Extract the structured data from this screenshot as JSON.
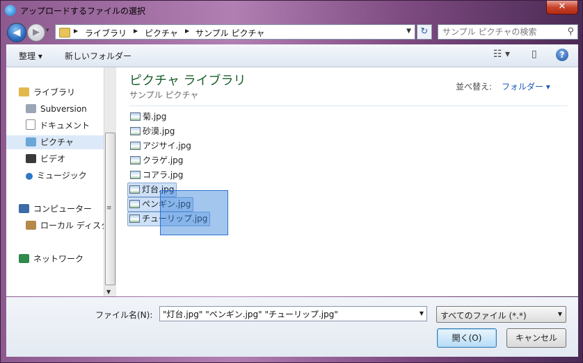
{
  "window": {
    "title": "アップロードするファイルの選択",
    "close_label": "✕"
  },
  "nav": {
    "back_label": "◀",
    "forward_label": "▶",
    "history_label": "▾",
    "breadcrumbs": [
      "ライブラリ",
      "ピクチャ",
      "サンプル ピクチャ"
    ],
    "search_placeholder": "サンプル ピクチャの検索",
    "refresh_label": "↻"
  },
  "toolbar": {
    "organize_label": "整理 ▾",
    "new_folder_label": "新しいフォルダー"
  },
  "sidebar": {
    "items": [
      {
        "label": "ライブラリ",
        "icon": "library-icon",
        "color": "#e2b84c"
      },
      {
        "label": "Subversion",
        "icon": "subversion-icon",
        "color": "#7a8aa0"
      },
      {
        "label": "ドキュメント",
        "icon": "document-icon",
        "color": "#ffffff"
      },
      {
        "label": "ピクチャ",
        "icon": "picture-icon",
        "color": "#6aa7d8"
      },
      {
        "label": "ビデオ",
        "icon": "video-icon",
        "color": "#3a3a3a"
      },
      {
        "label": "ミュージック",
        "icon": "music-icon",
        "color": "#2d78c8"
      },
      {
        "label": "コンピューター",
        "icon": "computer-icon",
        "color": "#3d6aa8"
      },
      {
        "label": "ローカル ディスク",
        "icon": "disk-icon",
        "color": "#b4894a"
      },
      {
        "label": "ネットワーク",
        "icon": "network-icon",
        "color": "#2f8a4c"
      }
    ]
  },
  "main": {
    "library_title": "ピクチャ ライブラリ",
    "library_subtitle": "サンプル ピクチャ",
    "sort_label": "並べ替え:",
    "sort_value": "フォルダー ▾",
    "files": [
      {
        "name": "菊.jpg",
        "selected": false
      },
      {
        "name": "砂漠.jpg",
        "selected": false
      },
      {
        "name": "アジサイ.jpg",
        "selected": false
      },
      {
        "name": "クラゲ.jpg",
        "selected": false
      },
      {
        "name": "コアラ.jpg",
        "selected": false
      },
      {
        "name": "灯台.jpg",
        "selected": true
      },
      {
        "name": "ペンギン.jpg",
        "selected": true
      },
      {
        "name": "チューリップ.jpg",
        "selected": true
      }
    ]
  },
  "bottom": {
    "filename_label": "ファイル名(N):",
    "filename_value": "\"灯台.jpg\" \"ペンギン.jpg\" \"チューリップ.jpg\"",
    "filetype_value": "すべてのファイル (*.*)",
    "open_label": "開く(O)",
    "cancel_label": "キャンセル"
  }
}
